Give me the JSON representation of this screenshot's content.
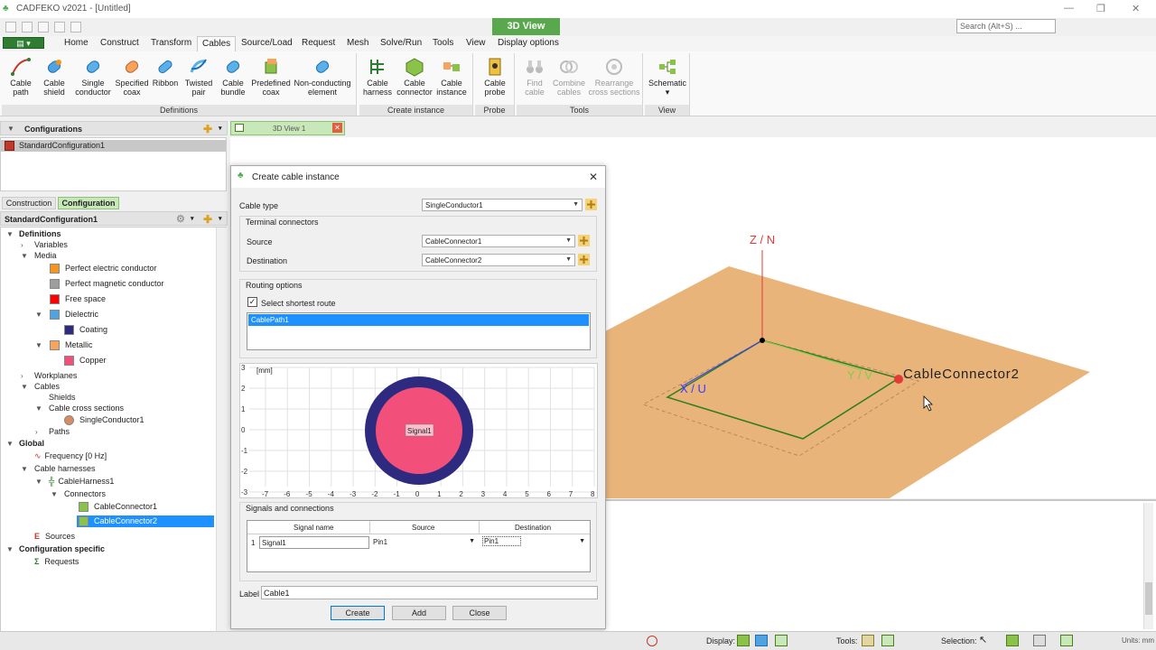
{
  "app": {
    "title": "CADFEKO v2021 - [Untitled]",
    "context_tab": "3D View",
    "search_placeholder": "Search (Alt+S) ..."
  },
  "menu": {
    "tabs": [
      "Home",
      "Construct",
      "Transform",
      "Cables",
      "Source/Load",
      "Request",
      "Mesh",
      "Solve/Run",
      "Tools",
      "View",
      "Display options"
    ],
    "active": "Cables"
  },
  "ribbon": {
    "groups": [
      {
        "label": "Definitions",
        "buttons": [
          [
            "Cable",
            "path"
          ],
          [
            "Cable",
            "shield"
          ],
          [
            "Single",
            "conductor"
          ],
          [
            "Specified",
            "coax"
          ],
          [
            "Ribbon",
            ""
          ],
          [
            "Twisted",
            "pair"
          ],
          [
            "Cable",
            "bundle"
          ],
          [
            "Predefined",
            "coax"
          ],
          [
            "Non-conducting",
            "element"
          ]
        ]
      },
      {
        "label": "Create instance",
        "buttons": [
          [
            "Cable",
            "harness"
          ],
          [
            "Cable",
            "connector"
          ],
          [
            "Cable",
            "instance"
          ]
        ]
      },
      {
        "label": "Probe",
        "buttons": [
          [
            "Cable",
            "probe"
          ]
        ]
      },
      {
        "label": "Tools",
        "buttons": [
          [
            "Find",
            "cable"
          ],
          [
            "Combine",
            "cables"
          ],
          [
            "Rearrange",
            "cross sections"
          ]
        ]
      },
      {
        "label": "View",
        "buttons": [
          [
            "Schematic",
            "▾"
          ]
        ]
      }
    ]
  },
  "left_panel": {
    "configurations_title": "Configurations",
    "config_item": "StandardConfiguration1",
    "tabs": [
      "Construction",
      "Configuration"
    ],
    "tree_title": "StandardConfiguration1",
    "tree": {
      "definitions": "Definitions",
      "variables": "Variables",
      "media": "Media",
      "pec": "Perfect electric conductor",
      "pmc": "Perfect magnetic conductor",
      "free_space": "Free space",
      "dielectric": "Dielectric",
      "coating": "Coating",
      "metallic": "Metallic",
      "copper": "Copper",
      "workplanes": "Workplanes",
      "cables": "Cables",
      "shields": "Shields",
      "cross_sections": "Cable cross sections",
      "single_conductor": "SingleConductor1",
      "paths": "Paths",
      "global": "Global",
      "frequency": "Frequency [0 Hz]",
      "harnesses": "Cable harnesses",
      "harness1": "CableHarness1",
      "connectors": "Connectors",
      "connector1": "CableConnector1",
      "connector2": "CableConnector2",
      "sources": "Sources",
      "config_specific": "Configuration specific",
      "requests": "Requests"
    },
    "colors": {
      "pec": "#f7941d",
      "pmc": "#9e9e9e",
      "free_space": "#ff0000",
      "coating": "#2e2a80",
      "copper": "#f2507a"
    }
  },
  "doc_tab": {
    "label": "3D View 1"
  },
  "dialog": {
    "title": "Create cable instance",
    "cable_type_label": "Cable type",
    "cable_type": "SingleConductor1",
    "terminal_label": "Terminal connectors",
    "source_label": "Source",
    "source_value": "CableConnector1",
    "destination_label": "Destination",
    "destination_value": "CableConnector2",
    "routing_label": "Routing options",
    "shortest_route_label": "Select shortest route",
    "shortest_route_checked": true,
    "route_item": "CablePath1",
    "plot_unit": "[mm]",
    "plot_xticks": [
      "-7",
      "-6",
      "-5",
      "-4",
      "-3",
      "-2",
      "-1",
      "0",
      "1",
      "2",
      "3",
      "4",
      "5",
      "6",
      "7",
      "8"
    ],
    "plot_yticks": [
      "3",
      "2",
      "1",
      "0",
      "-1",
      "-2",
      "-3"
    ],
    "signal_label": "Signal1",
    "signals_label": "Signals and connections",
    "col_signal": "Signal name",
    "col_source": "Source",
    "col_destination": "Destination",
    "row_index": "1",
    "row_signal": "Signal1",
    "row_source": "Pin1",
    "row_destination": "Pin1",
    "label_label": "Label",
    "label_value": "Cable1",
    "create": "Create",
    "add": "Add",
    "close": "Close"
  },
  "viewport": {
    "z_axis": "Z / N",
    "x_axis": "X / U",
    "y_axis": "Y / V",
    "connector_label": "CableConnector2"
  },
  "status": {
    "display": "Display:",
    "tools": "Tools:",
    "selection": "Selection:",
    "units": "Units: mm"
  }
}
